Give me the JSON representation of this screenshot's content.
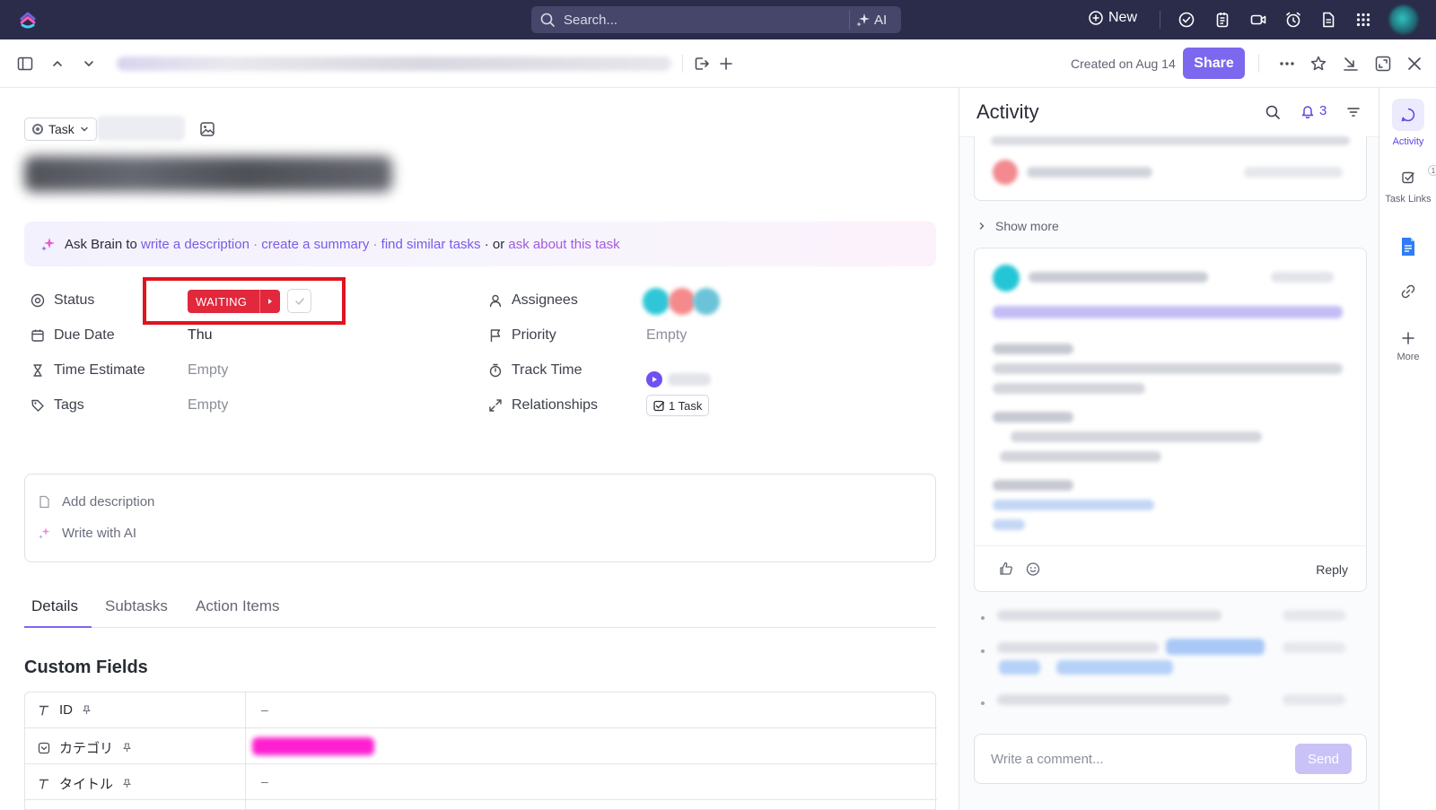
{
  "topbar": {
    "search_placeholder": "Search...",
    "ai_label": "AI",
    "new_label": "New"
  },
  "toolbar": {
    "created_text": "Created on Aug 14",
    "share_label": "Share"
  },
  "task": {
    "type_label": "Task",
    "ask_brain": {
      "prefix": "Ask Brain to ",
      "link_write": "write a description",
      "sep1": " · ",
      "link_summary": "create a summary",
      "sep2": " · ",
      "link_similar": "find similar tasks",
      "sep3": " · or ",
      "link_ask": "ask about this task"
    },
    "fields": {
      "status_label": "Status",
      "status_value": "WAITING",
      "due_label": "Due Date",
      "due_value": "Thu",
      "estimate_label": "Time Estimate",
      "estimate_value": "Empty",
      "tags_label": "Tags",
      "tags_value": "Empty",
      "assignees_label": "Assignees",
      "priority_label": "Priority",
      "priority_value": "Empty",
      "track_label": "Track Time",
      "relationships_label": "Relationships",
      "relationships_value": "1 Task"
    },
    "description": {
      "add_label": "Add description",
      "ai_label": "Write with AI"
    },
    "tabs": [
      "Details",
      "Subtasks",
      "Action Items"
    ],
    "custom_fields": {
      "title": "Custom Fields",
      "rows": [
        {
          "name": "ID",
          "value": "–"
        },
        {
          "name": "カテゴリ",
          "value": ""
        },
        {
          "name": "タイトル",
          "value": "–"
        }
      ]
    }
  },
  "activity": {
    "title": "Activity",
    "notification_count": "3",
    "show_more": "Show more",
    "reply_label": "Reply",
    "comment_placeholder": "Write a comment...",
    "send_label": "Send"
  },
  "rail": {
    "activity_label": "Activity",
    "task_links_label": "Task Links",
    "task_links_badge": "1",
    "more_label": "More"
  },
  "colors": {
    "brand": "#7b68ee",
    "status_waiting": "#e1283c",
    "highlight_box": "#e0131f",
    "nav_bg": "#2b2c4a"
  }
}
